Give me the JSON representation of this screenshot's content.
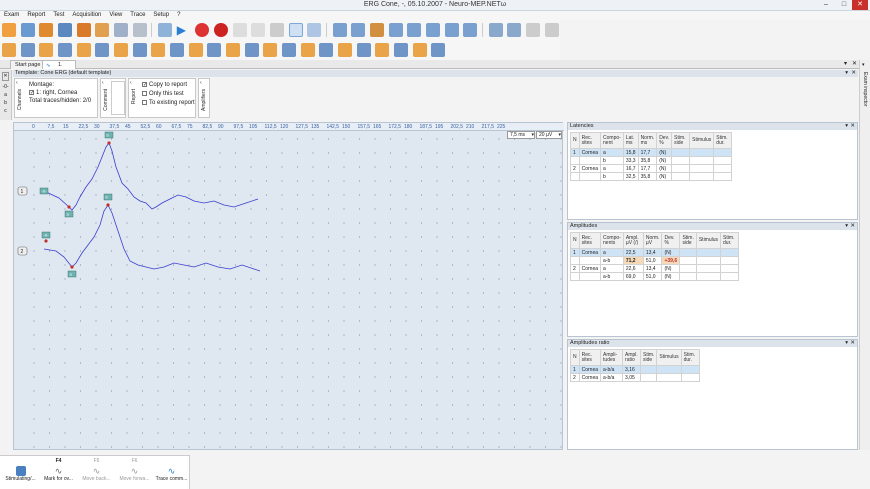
{
  "window": {
    "title": "ERG Cone, -, 05.10.2007 - Neuro-MEP.NETω"
  },
  "menu": [
    "Exam",
    "Report",
    "Test",
    "Acquisition",
    "View",
    "Trace",
    "Setup",
    "?"
  ],
  "tabs": [
    {
      "label": "Start page"
    },
    {
      "label": "1. Cone ERG"
    }
  ],
  "left_tools": [
    "-0-",
    "a",
    "b",
    "c"
  ],
  "template": {
    "title": "Template: Cone ERG (default template)"
  },
  "channels_panel": {
    "label": "Channels",
    "montage_label": "Montage:",
    "montage_value": "1: right, Cornea",
    "traces_label": "Total traces/hidden: 2/0"
  },
  "comment_panel": {
    "label": "Comment"
  },
  "report_panel": {
    "label": "Report",
    "options": [
      "Copy to report",
      "Only this test",
      "To existing report"
    ],
    "checked": [
      true,
      false,
      false
    ]
  },
  "amplifiers_panel": {
    "label": "Amplifiers"
  },
  "plot": {
    "scale_ticks": [
      "0",
      "7,5",
      "15",
      "22,5",
      "30",
      "37,5",
      "45",
      "52,5",
      "60",
      "67,5",
      "75",
      "82,5",
      "90",
      "97,5",
      "105",
      "112,5",
      "120",
      "127,5",
      "135",
      "142,5",
      "150",
      "157,5",
      "165",
      "172,5",
      "180",
      "187,5",
      "195",
      "202,5",
      "210",
      "217,5",
      "225"
    ],
    "sweep": "7,5 ms",
    "sensitivity": "20 µV",
    "traces": [
      {
        "num": "1",
        "markers": [
          "-0-",
          "a",
          "b"
        ]
      },
      {
        "num": "2",
        "markers": [
          "-0-",
          "a",
          "b"
        ]
      }
    ],
    "trace_color": "#3a3fcf"
  },
  "latencies": {
    "title": "Latencies",
    "headers": [
      "N",
      "Rec. sites",
      "Compo-nent",
      "Lat. ms",
      "Norm. ms",
      "Dev. %",
      "Stim. side",
      "Stimulus",
      "Stim. dur."
    ],
    "rows": [
      [
        "1",
        "Cornea",
        "a",
        "15,8",
        "17,7",
        "(N)",
        "",
        "",
        ""
      ],
      [
        "",
        "",
        "b",
        "33,3",
        "35,8",
        "(N)",
        "",
        "",
        ""
      ],
      [
        "2",
        "Cornea",
        "a",
        "16,7",
        "17,7",
        "(N)",
        "",
        "",
        ""
      ],
      [
        "",
        "",
        "b",
        "32,5",
        "35,8",
        "(N)",
        "",
        "",
        ""
      ]
    ]
  },
  "amplitudes": {
    "title": "Amplitudes",
    "headers": [
      "N",
      "Rec. sites",
      "Compo-nents",
      "Ampl. µV (/)",
      "Norm. µV",
      "Dev. %",
      "Stim. side",
      "Stimulus",
      "Stim. dur."
    ],
    "rows": [
      [
        "1",
        "Cornea",
        "a",
        "22,5",
        "13,4",
        "(N)",
        "",
        "",
        ""
      ],
      [
        "",
        "",
        "a-b",
        "71,2",
        "51,0",
        "+39,6",
        "",
        "",
        ""
      ],
      [
        "2",
        "Cornea",
        "a",
        "22,6",
        "13,4",
        "(N)",
        "",
        "",
        ""
      ],
      [
        "",
        "",
        "a-b",
        "69,0",
        "51,0",
        "(N)",
        "",
        "",
        ""
      ]
    ]
  },
  "ratio": {
    "title": "Amplitudes ratio",
    "headers": [
      "N",
      "Rec. sites",
      "Ampli-tudes",
      "Ampl. ratio",
      "Stim. side",
      "Stimulus",
      "Stim. dur."
    ],
    "rows": [
      [
        "1",
        "Cornea",
        "a-b/a",
        "3,16",
        "",
        "",
        ""
      ],
      [
        "2",
        "Cornea",
        "a-b/a",
        "3,05",
        "",
        "",
        ""
      ]
    ]
  },
  "bottom": [
    {
      "key": "",
      "label": "Stimulating/..."
    },
    {
      "key": "F4",
      "label": "Mark for ov..."
    },
    {
      "key": "F5",
      "label": "Move back..."
    },
    {
      "key": "F6",
      "label": "Move forwa..."
    },
    {
      "key": "",
      "label": "Trace comm..."
    }
  ],
  "right_strip": {
    "label": "Exam inspector"
  }
}
